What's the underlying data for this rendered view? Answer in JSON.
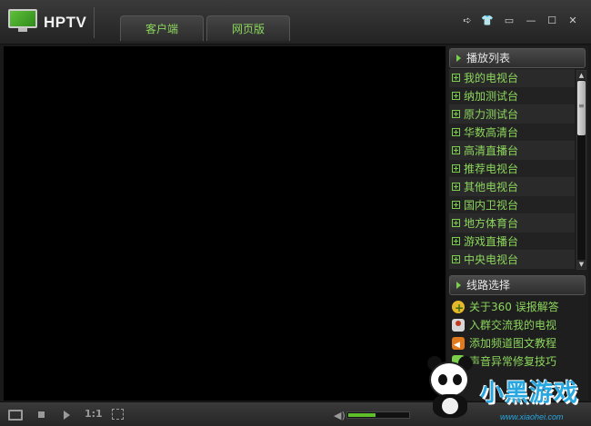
{
  "app": {
    "title": "HPTV"
  },
  "tabs": [
    {
      "label": "客户端"
    },
    {
      "label": "网页版"
    }
  ],
  "window_controls": [
    "share-icon",
    "shirt-skin-icon",
    "menu-icon",
    "minimize-icon",
    "maximize-icon",
    "close-icon"
  ],
  "playlist": {
    "header": "播放列表",
    "items": [
      {
        "label": "我的电视台"
      },
      {
        "label": "纳加测试台"
      },
      {
        "label": "原力测试台"
      },
      {
        "label": "华数高清台"
      },
      {
        "label": "高清直播台"
      },
      {
        "label": "推荐电视台"
      },
      {
        "label": "其他电视台"
      },
      {
        "label": "国内卫视台"
      },
      {
        "label": "地方体育台"
      },
      {
        "label": "游戏直播台"
      },
      {
        "label": "中央电视台"
      }
    ]
  },
  "route": {
    "header": "线路选择",
    "links": [
      {
        "label": "关于360 误报解答",
        "icon": "star-plus-icon"
      },
      {
        "label": "入群交流我的电视",
        "icon": "group-icon"
      },
      {
        "label": "添加频道图文教程",
        "icon": "speaker-icon"
      },
      {
        "label": "声音异常修复技巧",
        "icon": "file-icon"
      }
    ]
  },
  "controls": {
    "ratio_label": "1:1",
    "volume_level": 0.45
  },
  "watermark": {
    "text_main": "小黑游戏",
    "url": "www.xiaohei.com"
  },
  "colors": {
    "accent_green": "#8cd65c",
    "background": "#1a1a1a",
    "video": "#000000",
    "watermark_blue": "#27a7e0"
  }
}
